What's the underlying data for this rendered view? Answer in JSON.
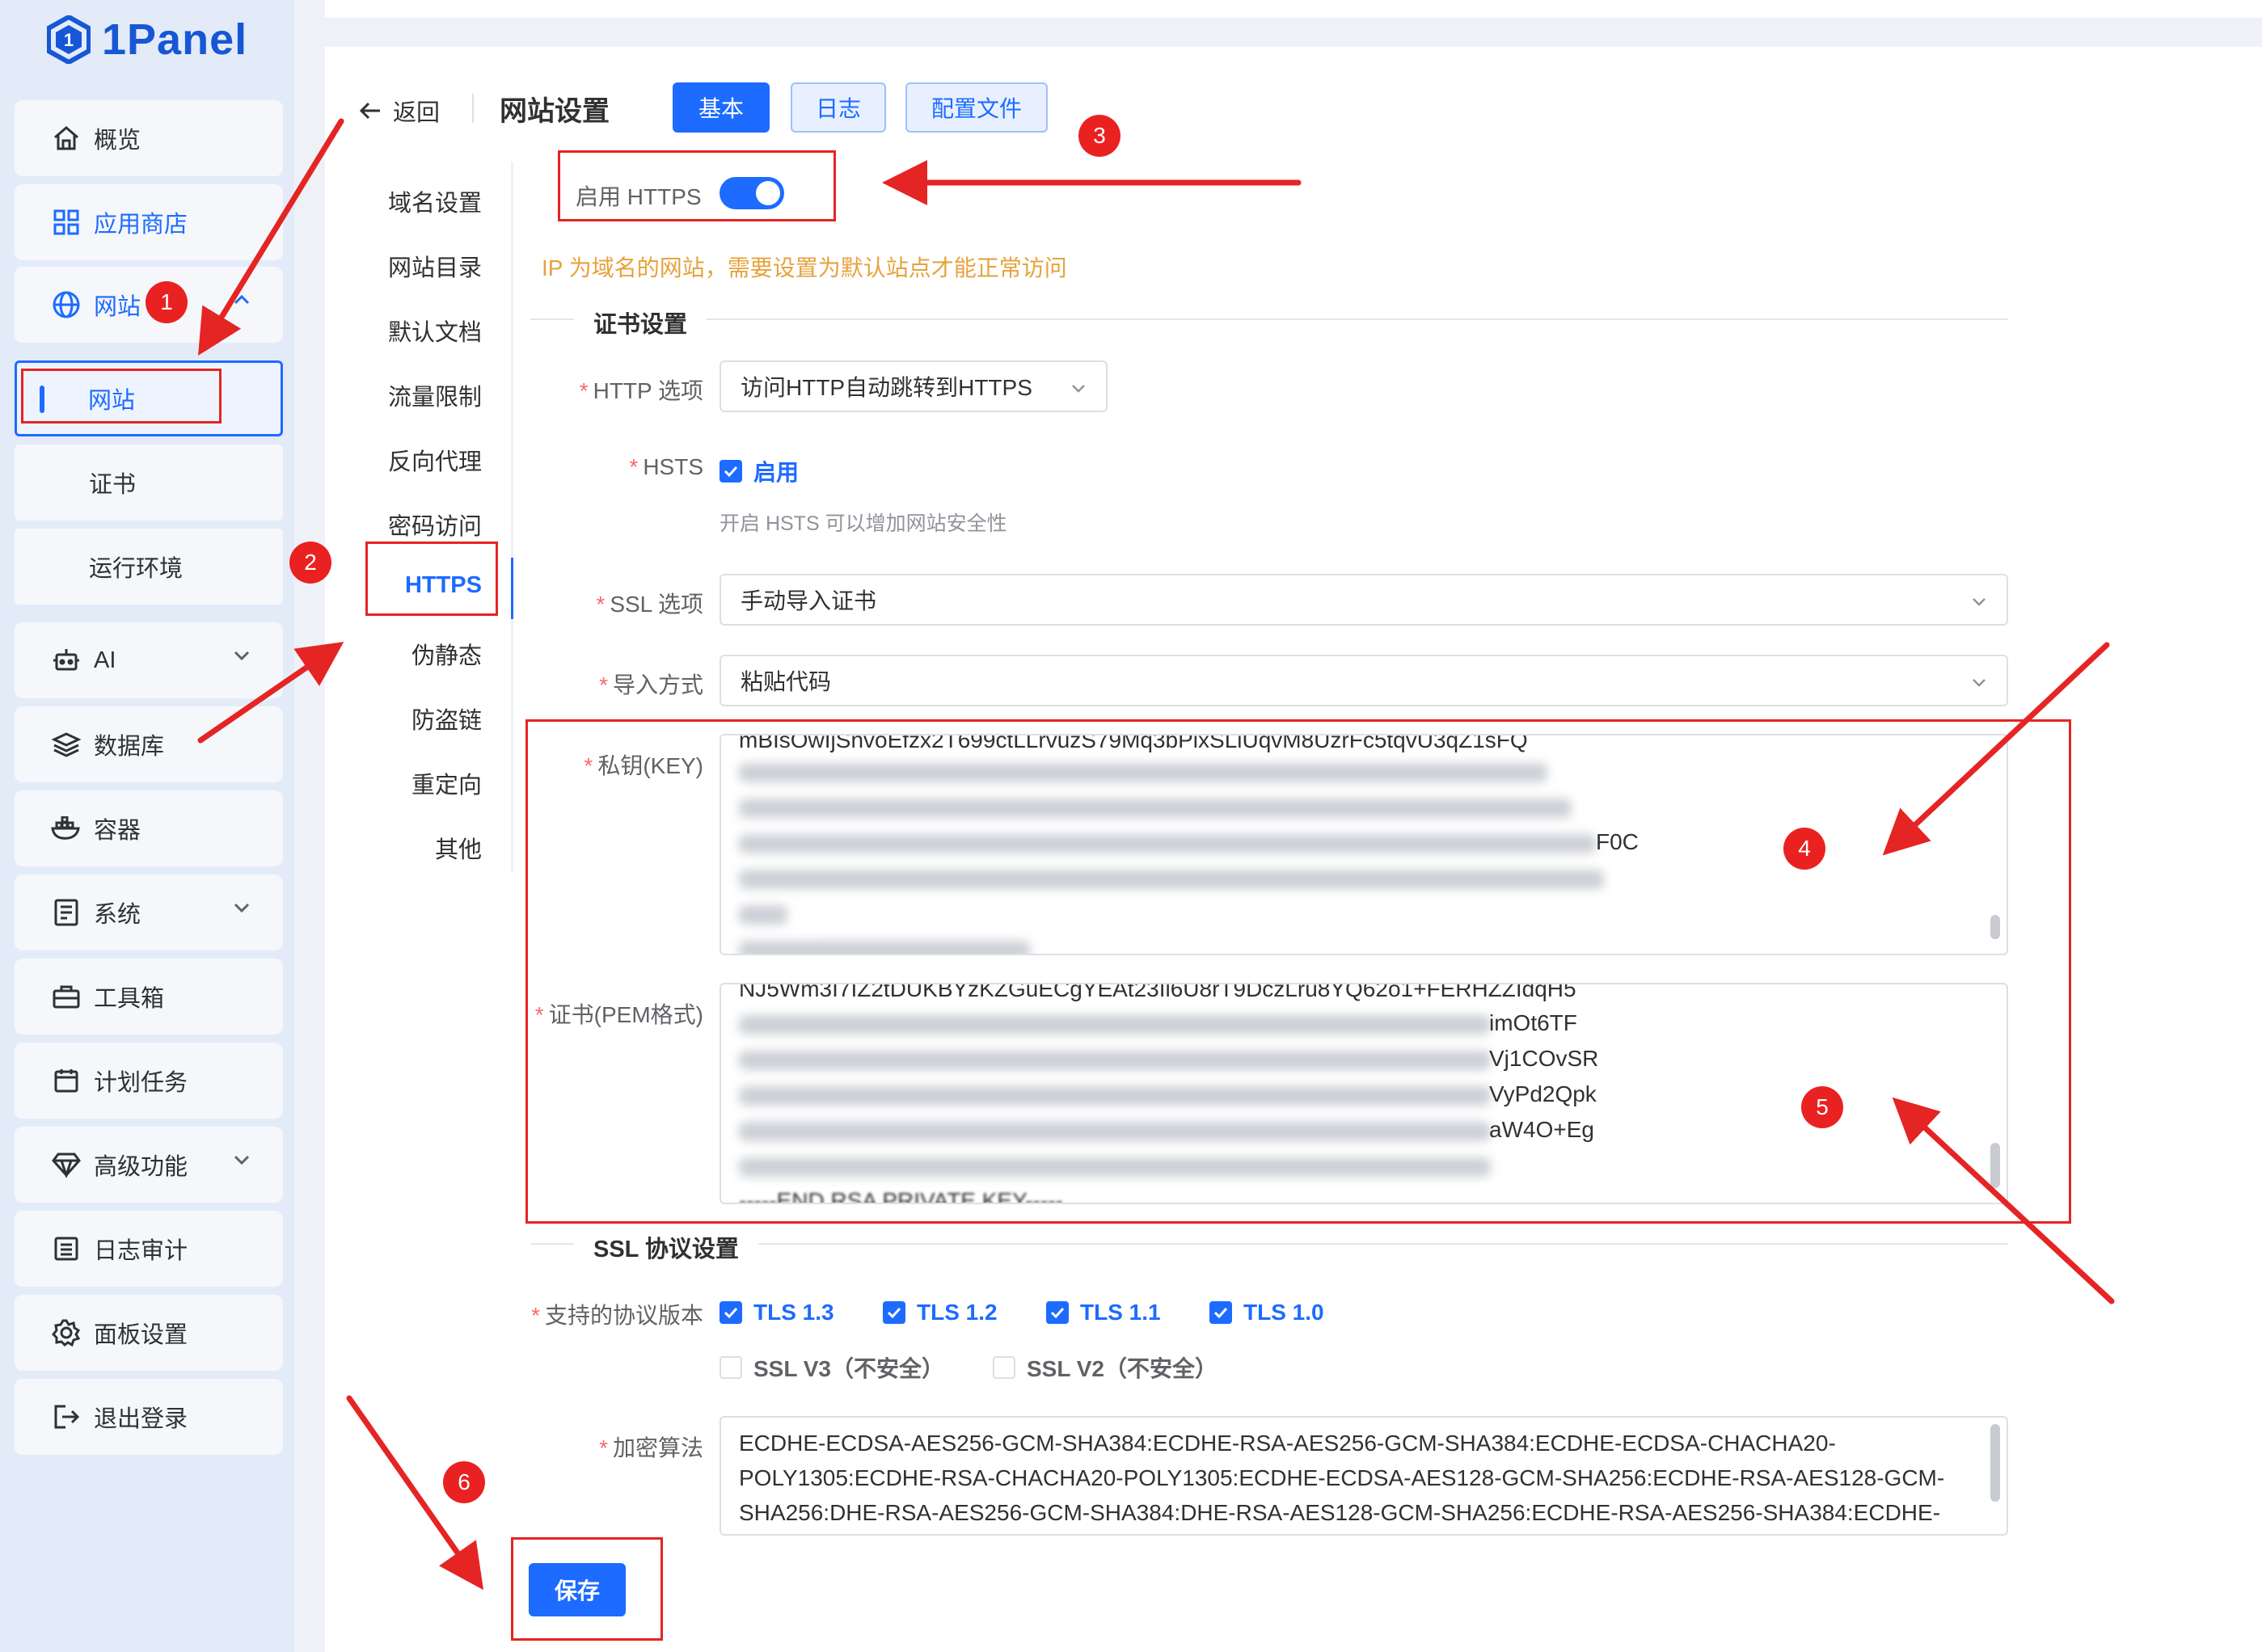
{
  "app": {
    "logo_text": "1Panel"
  },
  "sidebar": {
    "items": [
      {
        "label": "概览",
        "icon": "home-icon"
      },
      {
        "label": "应用商店",
        "icon": "apps-icon"
      },
      {
        "label": "网站",
        "icon": "globe-icon"
      },
      {
        "label": "AI",
        "icon": "robot-icon"
      },
      {
        "label": "数据库",
        "icon": "layers-icon"
      },
      {
        "label": "容器",
        "icon": "docker-icon"
      },
      {
        "label": "系统",
        "icon": "system-icon"
      },
      {
        "label": "工具箱",
        "icon": "toolbox-icon"
      },
      {
        "label": "计划任务",
        "icon": "calendar-icon"
      },
      {
        "label": "高级功能",
        "icon": "diamond-icon"
      },
      {
        "label": "日志审计",
        "icon": "log-icon"
      },
      {
        "label": "面板设置",
        "icon": "gear-icon"
      },
      {
        "label": "退出登录",
        "icon": "logout-icon"
      }
    ],
    "sub_items": [
      {
        "label": "网站"
      },
      {
        "label": "证书"
      },
      {
        "label": "运行环境"
      }
    ]
  },
  "header": {
    "back_label": "返回",
    "title": "网站设置",
    "tabs": [
      {
        "label": "基本"
      },
      {
        "label": "日志"
      },
      {
        "label": "配置文件"
      }
    ]
  },
  "left_nav": {
    "items": [
      "域名设置",
      "网站目录",
      "默认文档",
      "流量限制",
      "反向代理",
      "密码访问",
      "HTTPS",
      "伪静态",
      "防盗链",
      "重定向",
      "其他"
    ],
    "active": "HTTPS"
  },
  "https_form": {
    "enable_label": "启用 HTTPS",
    "enable_value": true,
    "warning": "IP 为域名的网站，需要设置为默认站点才能正常访问",
    "cert_section": "证书设置",
    "http_option_label": "HTTP 选项",
    "http_option_value": "访问HTTP自动跳转到HTTPS",
    "hsts_label": "HSTS",
    "hsts_checkbox": "启用",
    "hsts_hint": "开启 HSTS 可以增加网站安全性",
    "ssl_option_label": "SSL 选项",
    "ssl_option_value": "手动导入证书",
    "import_label": "导入方式",
    "import_value": "粘贴代码",
    "private_key_label": "私钥(KEY)",
    "private_key_visible": {
      "first_line": "mBIsOwIjSnvoEfzx2T699ctLLrvuzS79Mq3bPixSLiUqvM8UzrFc5tqvU3qZ1sFQ",
      "tail_fragment": "F0C"
    },
    "cert_label": "证书(PEM格式)",
    "cert_visible": {
      "first_line": "NJ5Wm3I7IZ2tDUKBYzKZGuECgYEAt23Il6U8rT9DczLru8YQ62o1+FERHZZIdqH5",
      "fragments": [
        "imOt6TF",
        "Vj1COvSR",
        "VyPd2Qpk",
        "aW4O+Eg"
      ],
      "footer": "-----END RSA PRIVATE KEY-----"
    },
    "ssl_section": "SSL 协议设置",
    "protocol_label": "支持的协议版本",
    "protocols": [
      {
        "label": "TLS 1.3",
        "checked": true
      },
      {
        "label": "TLS 1.2",
        "checked": true
      },
      {
        "label": "TLS 1.1",
        "checked": true
      },
      {
        "label": "TLS 1.0",
        "checked": true
      },
      {
        "label": "SSL V3（不安全）",
        "checked": false
      },
      {
        "label": "SSL V2（不安全）",
        "checked": false
      }
    ],
    "cipher_label": "加密算法",
    "cipher_lines": [
      "ECDHE-ECDSA-AES256-GCM-SHA384:ECDHE-RSA-AES256-GCM-SHA384:ECDHE-ECDSA-CHACHA20-",
      "POLY1305:ECDHE-RSA-CHACHA20-POLY1305:ECDHE-ECDSA-AES128-GCM-SHA256:ECDHE-RSA-AES128-GCM-",
      "SHA256:DHE-RSA-AES256-GCM-SHA384:DHE-RSA-AES128-GCM-SHA256:ECDHE-RSA-AES256-SHA384:ECDHE-"
    ],
    "save_label": "保存"
  },
  "annotations": {
    "badges": [
      "1",
      "2",
      "3",
      "4",
      "5",
      "6"
    ],
    "color": "#e52424"
  },
  "colors": {
    "primary": "#1d6bff",
    "warning": "#e6a23c",
    "required": "#f56c6c"
  }
}
